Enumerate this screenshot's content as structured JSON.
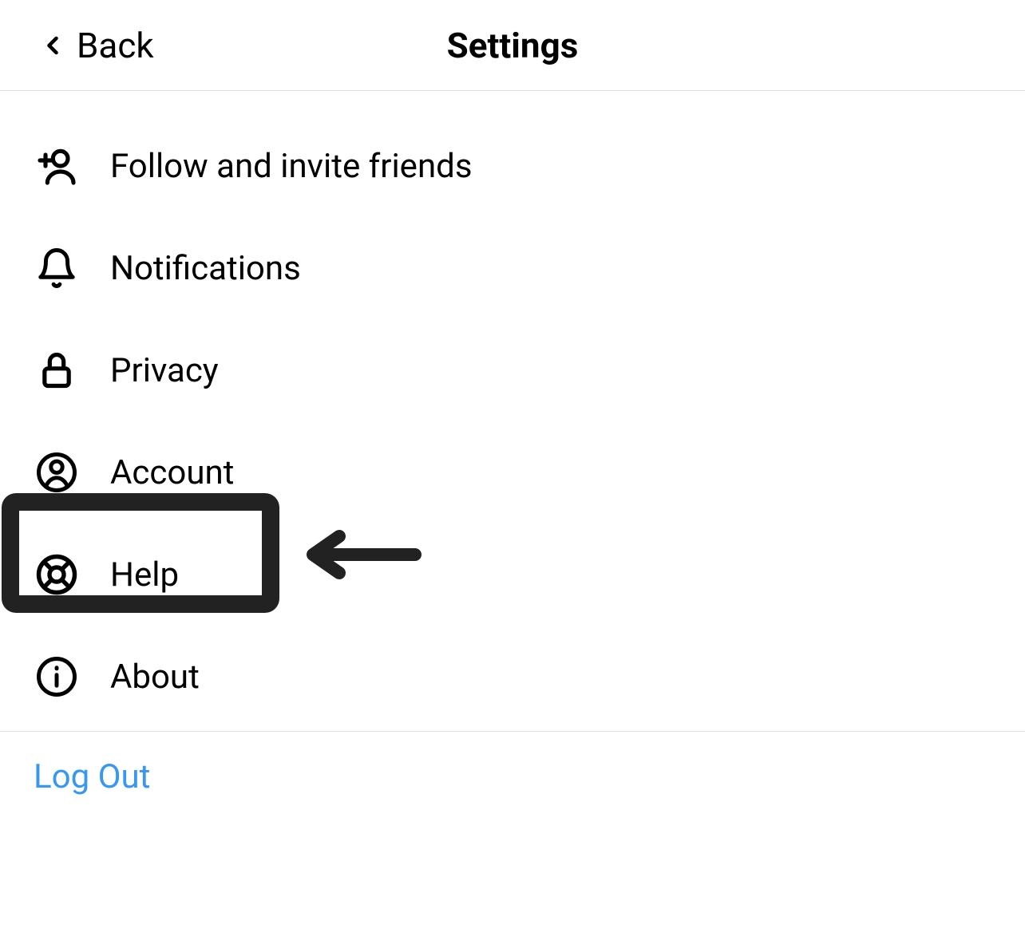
{
  "header": {
    "back_label": "Back",
    "title": "Settings"
  },
  "items": [
    {
      "icon": "person-add-icon",
      "label": "Follow and invite friends"
    },
    {
      "icon": "bell-icon",
      "label": "Notifications"
    },
    {
      "icon": "lock-icon",
      "label": "Privacy"
    },
    {
      "icon": "account-icon",
      "label": "Account"
    },
    {
      "icon": "help-icon",
      "label": "Help"
    },
    {
      "icon": "info-icon",
      "label": "About"
    }
  ],
  "logout_label": "Log Out",
  "annotation": {
    "highlighted_item_index": 4
  },
  "colors": {
    "link": "#3897f0",
    "text": "#000000",
    "divider": "#e0e0e0"
  }
}
